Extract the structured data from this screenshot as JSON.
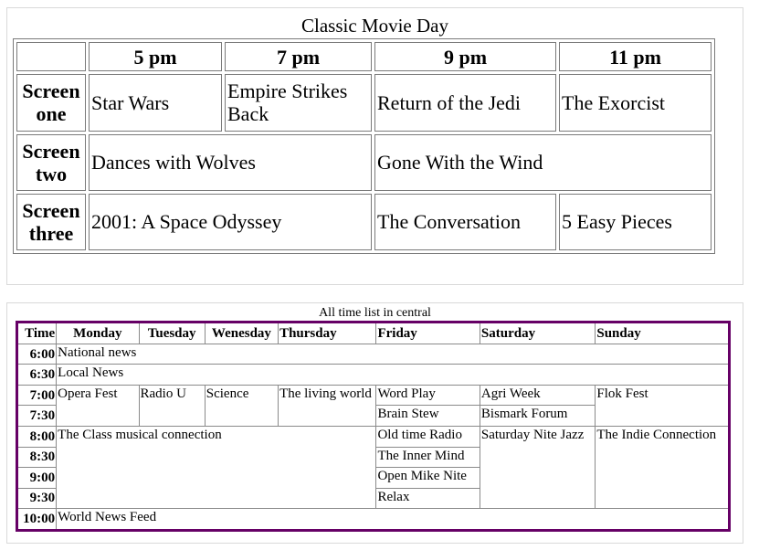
{
  "movie_day": {
    "caption": "Classic Movie Day",
    "times": [
      "5 pm",
      "7 pm",
      "9 pm",
      "11 pm"
    ],
    "screens": [
      {
        "label_line1": "Screen",
        "label_line2": "one",
        "films": [
          "Star Wars",
          "Empire Strikes Back",
          "Return of the Jedi",
          "The Exorcist"
        ]
      },
      {
        "label_line1": "Screen",
        "label_line2": "two",
        "films": [
          "Dances with Wolves",
          "Gone With the Wind"
        ]
      },
      {
        "label_line1": "Screen",
        "label_line2": "three",
        "films": [
          "2001: A Space Odyssey",
          "The Conversation",
          "5 Easy Pieces"
        ]
      }
    ]
  },
  "tv_schedule": {
    "caption": "All time list in central",
    "headers": [
      "Time",
      "Monday",
      "Tuesday",
      "Wenesday",
      "Thursday",
      "Friday",
      "Saturday",
      "Sunday"
    ],
    "times": [
      "6:00",
      "6:30",
      "7:00",
      "7:30",
      "8:00",
      "8:30",
      "9:00",
      "9:30",
      "10:00"
    ],
    "programs": {
      "national_news": "National news",
      "local_news": "Local News",
      "opera_fest": "Opera Fest",
      "radio_u": "Radio U",
      "science": "Science",
      "living_world": "The living world",
      "word_play": "Word Play",
      "agri_week": "Agri Week",
      "flok_fest": "Flok Fest",
      "brain_stew": "Brain Stew",
      "bismark_forum": "Bismark Forum",
      "class_musical": "The Class musical connection",
      "old_time_radio": "Old time Radio",
      "saturday_nite_jazz": "Saturday Nite Jazz",
      "indie_connection": "The Indie Connection",
      "inner_mind": "The Inner Mind",
      "open_mike": "Open Mike Nite",
      "relax": "Relax",
      "world_news_feed": "World News Feed"
    }
  }
}
